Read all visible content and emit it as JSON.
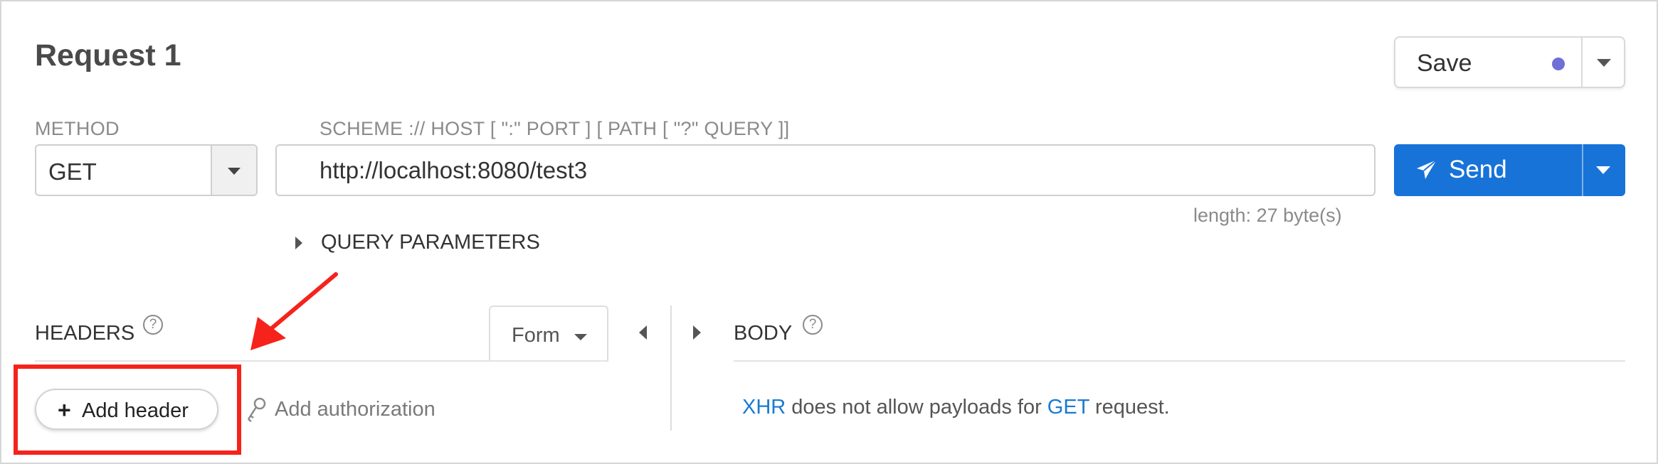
{
  "request": {
    "title": "Request 1",
    "save_label": "Save",
    "method_label": "METHOD",
    "method_value": "GET",
    "url_hint": "SCHEME :// HOST [ \":\" PORT ] [ PATH [ \"?\" QUERY ]]",
    "url_value": "http://localhost:8080/test3",
    "length_text": "length: 27 byte(s)",
    "send_label": "Send",
    "query_params_label": "QUERY PARAMETERS"
  },
  "headers": {
    "label": "HEADERS",
    "help_glyph": "?",
    "form_label": "Form",
    "add_header_plus": "+",
    "add_header_label": "Add header",
    "add_auth_label": "Add authorization"
  },
  "body": {
    "label": "BODY",
    "help_glyph": "?",
    "msg_kw1": "XHR",
    "msg_mid": " does not allow payloads for ",
    "msg_kw2": "GET",
    "msg_end": " request."
  },
  "icons": {
    "save_status": "status-dot-icon",
    "send": "paper-plane-icon",
    "auth": "key-icon",
    "annotation_arrow": "arrow-icon"
  },
  "colors": {
    "send_button": "#1773d8",
    "save_dot": "#6f6fd8",
    "link": "#1a7ad0",
    "annotation": "#f5231b"
  }
}
